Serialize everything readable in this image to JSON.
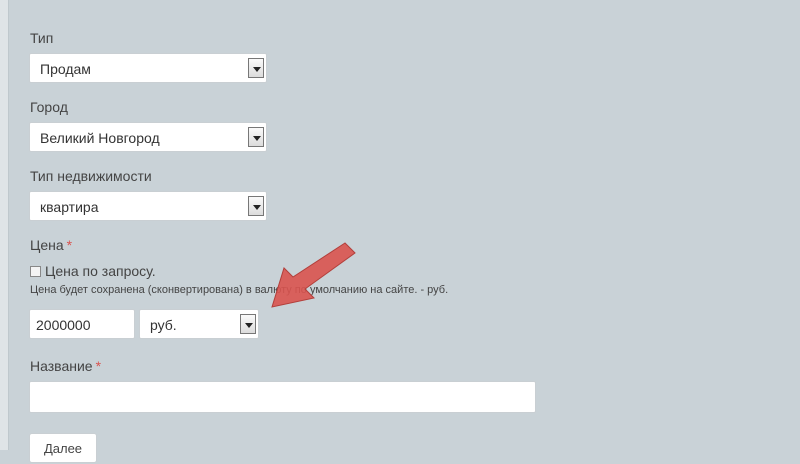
{
  "form": {
    "type_label": "Тип",
    "type_value": "Продам",
    "city_label": "Город",
    "city_value": "Великий Новгород",
    "property_type_label": "Тип недвижимости",
    "property_type_value": "квартира",
    "price_label": "Цена",
    "required_mark": "*",
    "price_on_request_label": "Цена по запросу.",
    "price_hint": "Цена будет сохранена (сконвертирована) в валюту по умолчанию на сайте. - руб.",
    "price_value": "2000000",
    "currency_value": "руб.",
    "title_label": "Название",
    "title_value": "",
    "next_button": "Далее"
  },
  "colors": {
    "background": "#c9d2d7",
    "required": "#d9534f",
    "annotation_arrow": "#d9534f"
  },
  "icons": {
    "dropdown": "chevron-down-icon",
    "annotation": "red-arrow-icon"
  }
}
